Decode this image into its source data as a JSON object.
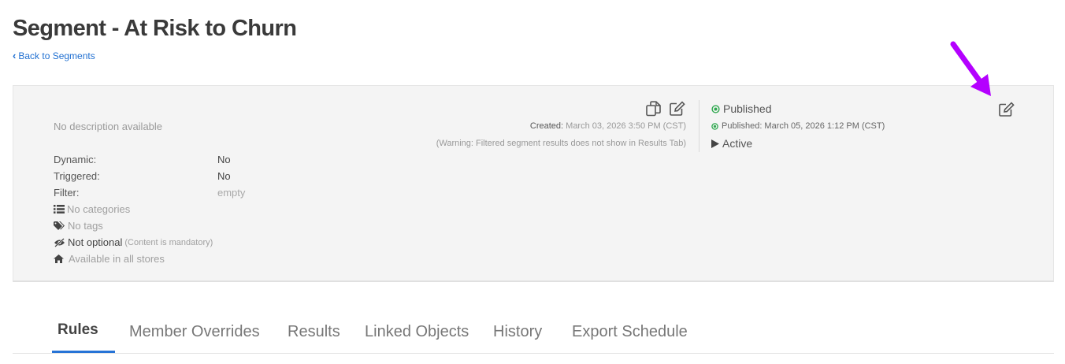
{
  "header": {
    "title": "Segment - At Risk to Churn",
    "back_label": "Back to Segments"
  },
  "panel": {
    "description": "No description available",
    "fields": [
      {
        "label": "Dynamic:",
        "value": "No"
      },
      {
        "label": "Triggered:",
        "value": "No"
      },
      {
        "label": "Filter:",
        "value": "empty"
      }
    ],
    "categories": "No categories",
    "tags": "No tags",
    "optional_label": "Not optional",
    "optional_note": "(Content is mandatory)",
    "stores": "Available in all stores",
    "created_label": "Created:",
    "created_value": "March 03, 2026 3:50 PM (CST)",
    "warning": "(Warning: Filtered segment results does not show in Results Tab)",
    "status": "Published",
    "published_at": "Published: March 05, 2026 1:12 PM (CST)",
    "active": "Active"
  },
  "tabs": [
    {
      "label": "Rules",
      "active": true
    },
    {
      "label": "Member Overrides"
    },
    {
      "label": "Results"
    },
    {
      "label": "Linked Objects"
    },
    {
      "label": "History"
    },
    {
      "label": "Export Schedule"
    }
  ],
  "colors": {
    "link": "#1f6fd1",
    "published_green": "#2fa84f",
    "annotation_arrow": "#b400ff",
    "tab_underline": "#2673d6"
  }
}
